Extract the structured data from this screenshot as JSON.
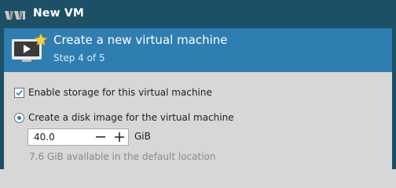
{
  "window": {
    "title": "New VM",
    "app_icon": "virt-manager-icon"
  },
  "header": {
    "title": "Create a new virtual machine",
    "step": "Step 4 of 5",
    "icon": "monitor-play-star-icon"
  },
  "storage": {
    "enable_label": "Enable storage for this virtual machine",
    "enable_checked": true,
    "create_label": "Create a disk image for the virtual machine",
    "create_selected": true,
    "size_value": "40.0",
    "size_unit": "GiB",
    "decrement_icon": "minus-icon",
    "increment_icon": "plus-icon",
    "available_text": "7.6 GiB available in the default location"
  },
  "colors": {
    "titlebar": "#1d4f66",
    "header": "#2f7eb1",
    "background": "#d7d7d7"
  }
}
